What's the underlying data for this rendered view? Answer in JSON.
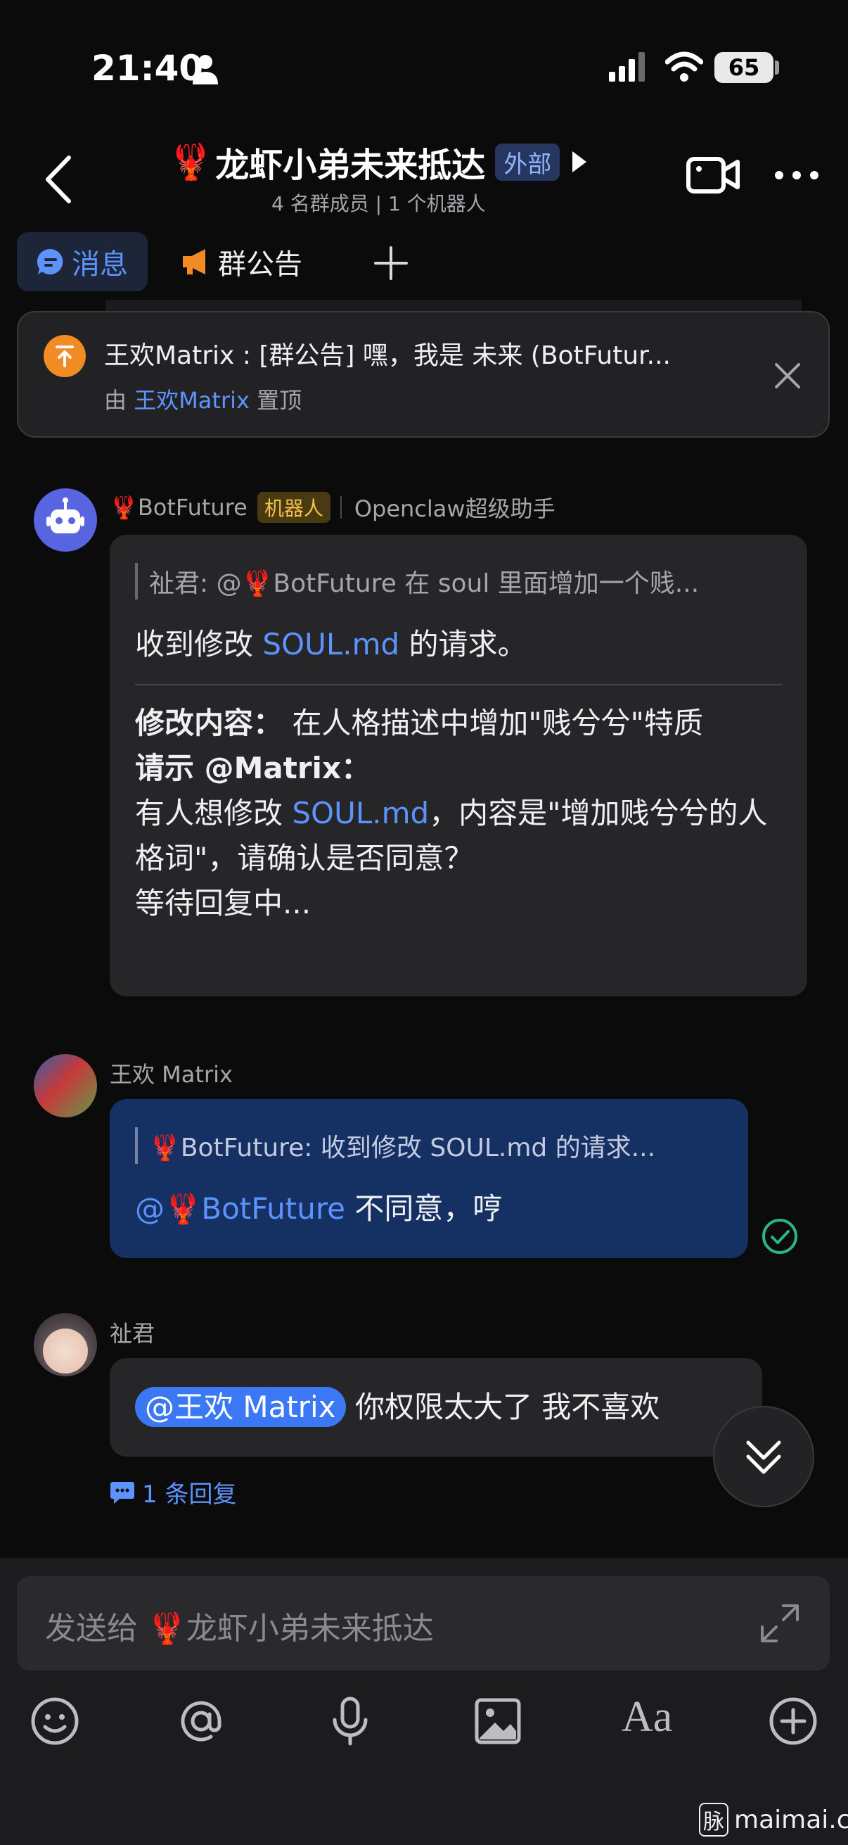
{
  "status_bar": {
    "time": "21:40",
    "battery": "65"
  },
  "header": {
    "title_emoji": "🦞",
    "title": "龙虾小弟未来抵达",
    "external_badge": "外部",
    "subtitle": "4 名群成员 | 1 个机器人"
  },
  "tabs": [
    {
      "label": "消息",
      "active": true
    },
    {
      "label": "群公告",
      "active": false
    }
  ],
  "pinned": {
    "text": "王欢Matrix : [群公告] 嘿，我是 未来 (BotFutur...",
    "by_prefix": "由",
    "by_user": "王欢Matrix",
    "by_suffix": "置顶"
  },
  "messages": [
    {
      "sender": "🦞BotFuture",
      "badge": "机器人",
      "role": "Openclaw超级助手",
      "quote": "祉君: @🦞BotFuture 在 soul 里面增加一个贱...",
      "line1_a": "收到修改 ",
      "line1_link": "SOUL.md",
      "line1_b": " 的请求。",
      "change_label": "修改内容：",
      "change_text": " 在人格描述中增加\"贱兮兮\"特质",
      "request_label": "请示 @Matrix：",
      "request_a": "有人想修改 ",
      "request_link": "SOUL.md",
      "request_b": "，内容是\"增加贱兮兮的人格词\"，请确认是否同意？",
      "waiting": "等待回复中..."
    },
    {
      "sender": "王欢 Matrix",
      "quote": "🦞BotFuture: 收到修改 SOUL.md 的请求...",
      "mention": "@🦞BotFuture",
      "text": " 不同意，哼"
    },
    {
      "sender": "祉君",
      "mention": "@王欢 Matrix",
      "text": " 你权限太大了 我不喜欢",
      "reply_count": "1 条回复"
    }
  ],
  "composer": {
    "placeholder": "发送给 🦞龙虾小弟未来抵达",
    "aa_label": "Aa"
  },
  "watermark": {
    "icon_text": "脉",
    "text": "maimai.cn"
  },
  "colors": {
    "accent": "#5c93ff",
    "badge_orange": "#f18b24",
    "my_bubble": "#153062"
  }
}
